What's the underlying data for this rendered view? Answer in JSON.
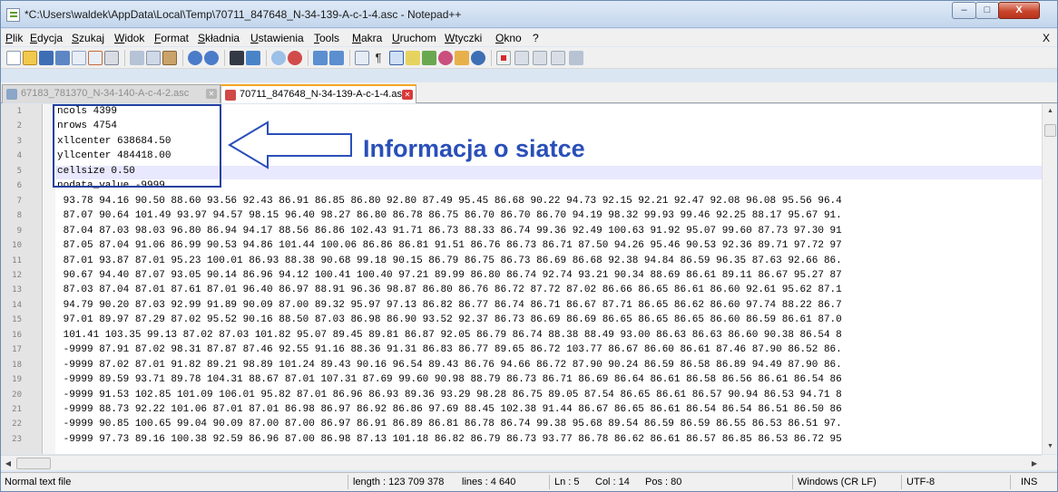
{
  "window": {
    "title": "*C:\\Users\\waldek\\AppData\\Local\\Temp\\70711_847648_N-34-139-A-c-1-4.asc - Notepad++",
    "min_glyph": "–",
    "max_glyph": "□",
    "close_glyph": "X"
  },
  "menu": {
    "items": [
      "Plik",
      "Edycja",
      "Szukaj",
      "Widok",
      "Format",
      "Składnia",
      "Ustawienia",
      "Tools",
      "Makra",
      "Uruchom",
      "Wtyczki",
      "Okno",
      "?"
    ],
    "close_doc": "X"
  },
  "toolbar": {
    "icons": [
      "new-file",
      "open-file",
      "save",
      "save-all",
      "close",
      "close-all",
      "print",
      "cut",
      "copy",
      "paste",
      "undo",
      "redo",
      "find",
      "replace",
      "zoom-in",
      "zoom-out",
      "sync-vertical",
      "sync-horizontal",
      "word-wrap",
      "show-all-chars",
      "indent-guide",
      "user-language",
      "doc-map",
      "function-list",
      "folder-workspace",
      "monitoring",
      "record-macro",
      "stop-macro",
      "play-macro",
      "run-macro-multiple",
      "save-macro"
    ]
  },
  "tabs": [
    {
      "label": "67183_781370_N-34-140-A-c-4-2.asc",
      "active": false
    },
    {
      "label": "70711_847648_N-34-139-A-c-1-4.asc",
      "active": true
    }
  ],
  "editor": {
    "line_numbers": [
      "1",
      "2",
      "3",
      "4",
      "5",
      "6",
      "7",
      "8",
      "9",
      "10",
      "11",
      "12",
      "13",
      "14",
      "15",
      "16",
      "17",
      "18",
      "19",
      "20",
      "21",
      "22",
      "23"
    ],
    "lines": [
      "ncols 4399",
      "nrows 4754",
      "xllcenter 638684.50",
      "yllcenter 484418.00",
      "cellsize 0.50",
      "nodata_value -9999",
      " 93.78 94.16 90.50 88.60 93.56 92.43 86.91 86.85 86.80 92.80 87.49 95.45 86.68 90.22 94.73 92.15 92.21 92.47 92.08 96.08 95.56 96.4",
      " 87.07 90.64 101.49 93.97 94.57 98.15 96.40 98.27 86.80 86.78 86.75 86.70 86.70 86.70 94.19 98.32 99.93 99.46 92.25 88.17 95.67 91.",
      " 87.04 87.03 98.03 96.80 86.94 94.17 88.56 86.86 102.43 91.71 86.73 88.33 86.74 99.36 92.49 100.63 91.92 95.07 99.60 87.73 97.30 91",
      " 87.05 87.04 91.06 86.99 90.53 94.86 101.44 100.06 86.86 86.81 91.51 86.76 86.73 86.71 87.50 94.26 95.46 90.53 92.36 89.71 97.72 97",
      " 87.01 93.87 87.01 95.23 100.01 86.93 88.38 90.68 99.18 90.15 86.79 86.75 86.73 86.69 86.68 92.38 94.84 86.59 96.35 87.63 92.66 86.",
      " 90.67 94.40 87.07 93.05 90.14 86.96 94.12 100.41 100.40 97.21 89.99 86.80 86.74 92.74 93.21 90.34 88.69 86.61 89.11 86.67 95.27 87",
      " 87.03 87.04 87.01 87.61 87.01 96.40 86.97 88.91 96.36 98.87 86.80 86.76 86.72 87.72 87.02 86.66 86.65 86.61 86.60 92.61 95.62 87.1",
      " 94.79 90.20 87.03 92.99 91.89 90.09 87.00 89.32 95.97 97.13 86.82 86.77 86.74 86.71 86.67 87.71 86.65 86.62 86.60 97.74 88.22 86.7",
      " 97.01 89.97 87.29 87.02 95.52 90.16 88.50 87.03 86.98 86.90 93.52 92.37 86.73 86.69 86.69 86.65 86.65 86.65 86.60 86.59 86.61 87.0",
      " 101.41 103.35 99.13 87.02 87.03 101.82 95.07 89.45 89.81 86.87 92.05 86.79 86.74 88.38 88.49 93.00 86.63 86.63 86.60 90.38 86.54 8",
      " -9999 87.91 87.02 98.31 87.87 87.46 92.55 91.16 88.36 91.31 86.83 86.77 89.65 86.72 103.77 86.67 86.60 86.61 87.46 87.90 86.52 86.",
      " -9999 87.02 87.01 91.82 89.21 98.89 101.24 89.43 90.16 96.54 89.43 86.76 94.66 86.72 87.90 90.24 86.59 86.58 86.89 94.49 87.90 86.",
      " -9999 89.59 93.71 89.78 104.31 88.67 87.01 107.31 87.69 99.60 90.98 88.79 86.73 86.71 86.69 86.64 86.61 86.58 86.56 86.61 86.54 86",
      " -9999 91.53 102.85 101.09 106.01 95.82 87.01 86.96 86.93 89.36 93.29 98.28 86.75 89.05 87.54 86.65 86.61 86.57 90.94 86.53 94.71 8",
      " -9999 88.73 92.22 101.06 87.01 87.01 86.98 86.97 86.92 86.86 97.69 88.45 102.38 91.44 86.67 86.65 86.61 86.54 86.54 86.51 86.50 86",
      " -9999 90.85 100.65 99.04 90.09 87.00 87.00 86.97 86.91 86.89 86.81 86.78 86.74 99.38 95.68 89.54 86.59 86.59 86.55 86.53 86.51 97.",
      " -9999 97.73 89.16 100.38 92.59 86.96 87.00 86.98 87.13 101.18 86.82 86.79 86.73 93.77 86.78 86.62 86.61 86.57 86.85 86.53 86.72 95"
    ]
  },
  "annotation": {
    "text": "Informacja o siatce",
    "color": "#2a4fb8"
  },
  "status": {
    "file_type": "Normal text file",
    "length": "length : 123 709 378",
    "lines": "lines : 4 640",
    "ln": "Ln : 5",
    "col": "Col : 14",
    "pos": "Pos : 80",
    "eol": "Windows (CR LF)",
    "encoding": "UTF-8",
    "mode": "INS"
  },
  "scroll": {
    "up": "▲",
    "down": "▼",
    "left": "◀",
    "right": "▶"
  }
}
